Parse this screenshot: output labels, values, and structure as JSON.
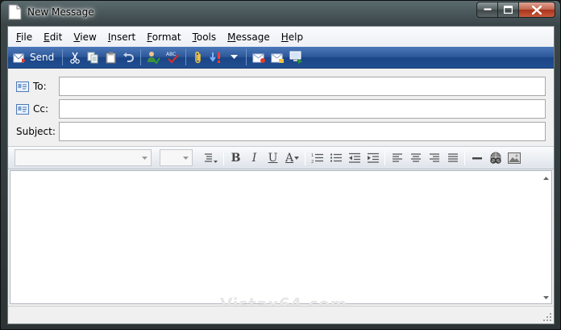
{
  "window": {
    "title": "New Message"
  },
  "menu": [
    {
      "ul": "F",
      "rest": "ile"
    },
    {
      "ul": "E",
      "rest": "dit"
    },
    {
      "ul": "V",
      "rest": "iew"
    },
    {
      "ul": "I",
      "rest": "nsert"
    },
    {
      "ul": "F",
      "rest": "ormat"
    },
    {
      "ul": "T",
      "rest": "ools"
    },
    {
      "ul": "M",
      "rest": "essage"
    },
    {
      "ul": "H",
      "rest": "elp"
    }
  ],
  "toolbar": {
    "send_label": "Send",
    "spell_glyph": "ABC"
  },
  "fields": {
    "to_label": "To:",
    "to_value": "",
    "cc_label": "Cc:",
    "cc_value": "",
    "subject_label": "Subject:",
    "subject_value": ""
  },
  "format": {
    "font_name": "",
    "font_size": "",
    "bold": "B",
    "italic": "I",
    "underline": "U",
    "font_color": "A"
  },
  "body": {
    "text": "",
    "watermark": "Vistax64.com"
  },
  "colors": {
    "toolbar_blue": "#2c5799",
    "close_red": "#c0624a"
  }
}
